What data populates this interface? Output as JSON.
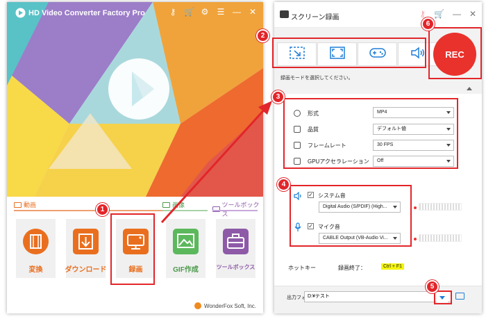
{
  "left_window": {
    "title": "HD Video Converter Factory Pro",
    "icons": [
      "key-icon",
      "cart-icon",
      "settings-icon",
      "list-icon",
      "minimize-icon",
      "close-icon"
    ],
    "sections": {
      "video": "動画",
      "image": "画像",
      "toolbox": "ツールボックス"
    },
    "tiles": [
      {
        "label": "変換",
        "icon": "film-icon"
      },
      {
        "label": "ダウンロード",
        "icon": "download-icon"
      },
      {
        "label": "録画",
        "icon": "screen-record-icon"
      },
      {
        "label": "GIF作成",
        "icon": "image-icon"
      },
      {
        "label": "ツールボックス",
        "icon": "toolbox-icon"
      }
    ],
    "footer": "WonderFox Soft, Inc.",
    "colors": {
      "accent": "#e96f1f",
      "toolbox": "#8e5aa8"
    }
  },
  "right_window": {
    "title": "スクリーン録画",
    "title_icons": [
      "key-icon",
      "cart-icon",
      "minimize-icon",
      "close-icon"
    ],
    "mode_buttons": [
      "region-capture-icon",
      "fullscreen-capture-icon",
      "game-capture-icon",
      "audio-only-icon"
    ],
    "mode_hint": "録画モードを選択してください。",
    "rec_label": "REC",
    "settings": [
      {
        "label": "形式",
        "value": "MP4"
      },
      {
        "label": "品質",
        "value": "デフォルト値"
      },
      {
        "label": "フレームレート",
        "value": "30 FPS"
      },
      {
        "label": "GPUアクセラレーション",
        "value": "Off"
      }
    ],
    "audio": {
      "system_label": "システム音",
      "system_checked": true,
      "system_device": "Digital Audio (S/PDIF) (High...",
      "mic_label": "マイク音",
      "mic_checked": true,
      "mic_device": "CABLE Output (VB-Audio Vi..."
    },
    "hotkey_label": "ホットキー",
    "end_record_label": "録画終了：",
    "end_record_key": "Ctrl + F1",
    "output_folder_label": "出力フォルダ：",
    "output_folder_value": "D:¥テスト",
    "colors": {
      "rec": "#e9322c",
      "link": "#1e7fd8",
      "hotkey_bg": "#f4f40a"
    }
  },
  "callouts": [
    "1",
    "2",
    "3",
    "4",
    "5",
    "6"
  ],
  "callout_color": "#e2252a"
}
